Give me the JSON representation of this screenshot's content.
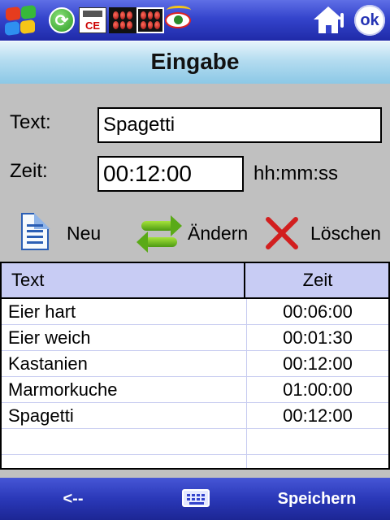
{
  "taskbar": {
    "icons": [
      "windows-start-icon",
      "refresh-app-icon",
      "ce-app-icon",
      "dots-app-icon",
      "dots-app-icon-active",
      "eye-app-icon"
    ],
    "home_icon": "home-icon",
    "ok_label": "ok"
  },
  "header": {
    "title": "Eingabe"
  },
  "form": {
    "text_label": "Text:",
    "text_value": "Spagetti",
    "time_label": "Zeit:",
    "time_value": "00:12:00",
    "time_format": "hh:mm:ss"
  },
  "actions": {
    "new_label": "Neu",
    "change_label": "Ändern",
    "delete_label": "Löschen"
  },
  "list": {
    "columns": [
      "Text",
      "Zeit"
    ],
    "rows": [
      {
        "text": "Eier hart",
        "time": "00:06:00"
      },
      {
        "text": "Eier weich",
        "time": "00:01:30"
      },
      {
        "text": "Kastanien",
        "time": "00:12:00"
      },
      {
        "text": "Marmorkuche",
        "time": "01:00:00"
      },
      {
        "text": "Spagetti",
        "time": "00:12:00"
      },
      {
        "text": "",
        "time": ""
      },
      {
        "text": "",
        "time": ""
      }
    ]
  },
  "bottombar": {
    "left_label": "<--",
    "keyboard_icon": "keyboard-icon",
    "right_label": "Speichern"
  },
  "colors": {
    "taskbar": "#3444cc",
    "title_bar": "#b4dcf0",
    "list_header": "#c8ccf4",
    "bottom_bar": "#2a38b8"
  }
}
